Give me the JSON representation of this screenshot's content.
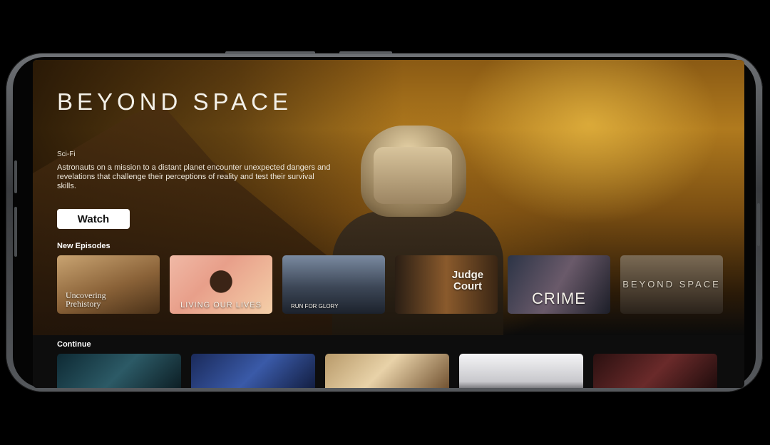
{
  "hero": {
    "title": "BEYOND SPACE",
    "genre": "Sci-Fi",
    "description": "Astronauts on a mission to a distant planet encounter unexpected dangers and revelations that challenge their perceptions of reality and test their survival skills.",
    "watch_label": "Watch"
  },
  "sections": {
    "new_episodes_label": "New Episodes",
    "continue_label": "Continue"
  },
  "new_episodes": [
    {
      "label": "Uncovering Prehistory"
    },
    {
      "label": "LIVING OUR LIVES"
    },
    {
      "label": "RUN FOR GLORY"
    },
    {
      "label": "Judge Court"
    },
    {
      "label": "CRIME"
    },
    {
      "label": "BEYOND SPACE"
    }
  ],
  "colors": {
    "accent_hero": "#b07a1e",
    "button_bg": "#ffffff",
    "background": "#000000"
  }
}
